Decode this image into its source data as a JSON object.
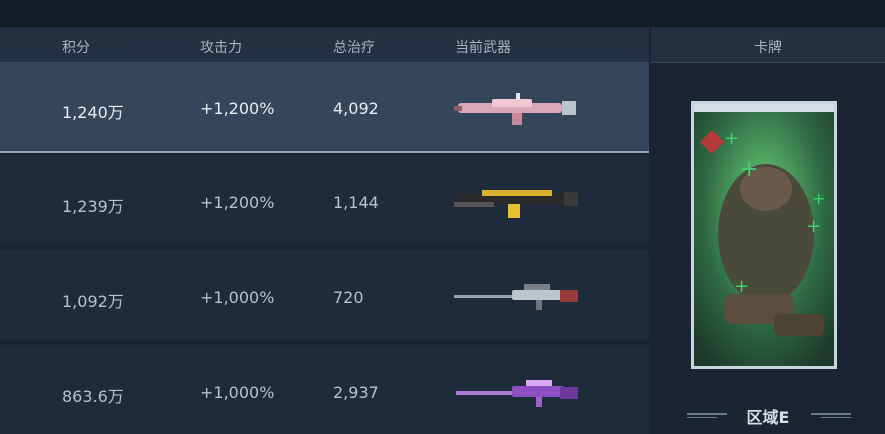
{
  "headers": {
    "score": "积分",
    "attack": "攻击力",
    "healing": "总治疗",
    "weapon": "当前武器"
  },
  "rows": [
    {
      "score": "1,240万",
      "attack": "+1,200%",
      "healing": "4,092",
      "weapon_icon": "pink-rifle-icon"
    },
    {
      "score": "1,239万",
      "attack": "+1,200%",
      "healing": "1,144",
      "weapon_icon": "gold-rifle-icon"
    },
    {
      "score": "1,092万",
      "attack": "+1,000%",
      "healing": "720",
      "weapon_icon": "sniper-rifle-icon"
    },
    {
      "score": "863.6万",
      "attack": "+1,000%",
      "healing": "2,937",
      "weapon_icon": "purple-sniper-icon"
    }
  ],
  "card": {
    "title": "卡牌",
    "zone": "区域E"
  },
  "colors": {
    "selected_row": "#36465a",
    "row": "#1f2a3a",
    "accent_green": "#3bd46a"
  }
}
